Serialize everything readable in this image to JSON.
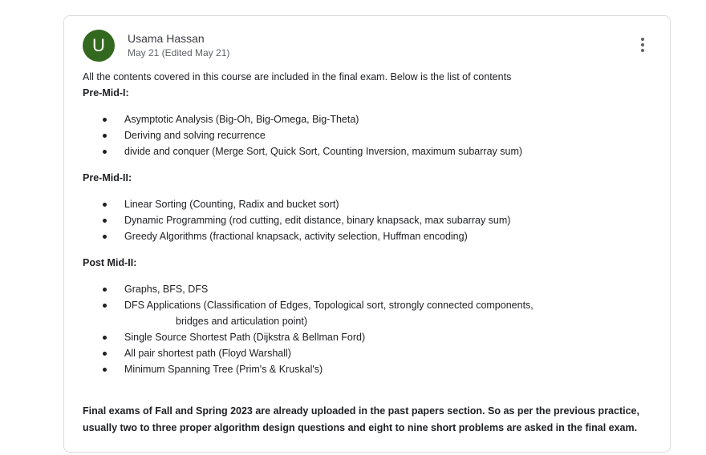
{
  "post": {
    "avatar_letter": "U",
    "author": "Usama Hassan",
    "date": "May 21 (Edited May 21)",
    "intro": "All the contents covered in this course are included in the final exam. Below is the list of contents",
    "sections": [
      {
        "title": "Pre-Mid-I:",
        "items": [
          "Asymptotic Analysis (Big-Oh, Big-Omega, Big-Theta)",
          "Deriving and solving recurrence",
          "divide and conquer (Merge Sort, Quick Sort, Counting Inversion, maximum subarray sum)"
        ]
      },
      {
        "title": "Pre-Mid-II:",
        "items": [
          "Linear Sorting (Counting, Radix and bucket sort)",
          "Dynamic Programming (rod cutting, edit distance, binary knapsack, max subarray sum)",
          "Greedy Algorithms (fractional knapsack, activity selection, Huffman encoding)"
        ]
      },
      {
        "title": "Post Mid-II:",
        "items": [
          "Graphs, BFS, DFS",
          "DFS Applications (Classification of Edges, Topological sort, strongly connected components,",
          "Single Source Shortest Path (Dijkstra & Bellman Ford)",
          "All pair shortest path (Floyd Warshall)",
          "Minimum Spanning Tree (Prim's & Kruskal's)"
        ],
        "item_continuation": "bridges and articulation point)"
      }
    ],
    "final_note": "Final exams of Fall and Spring 2023 are already uploaded in the past papers section. So as per the previous practice, usually two to three proper algorithm design questions and eight to nine short problems are asked in the final exam.",
    "colors": {
      "avatar_bg": "#33691e",
      "border": "#dadce0"
    },
    "icons": {
      "menu": "more-vert-icon"
    }
  }
}
